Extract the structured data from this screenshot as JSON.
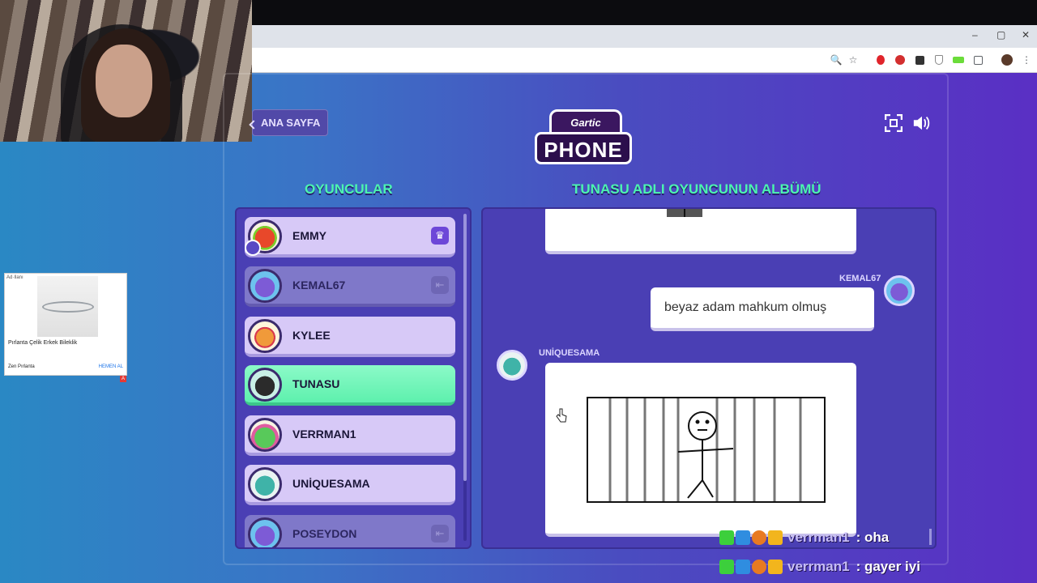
{
  "browser": {
    "window_controls": [
      "–",
      "▢",
      "✕"
    ],
    "toolbar_icons": [
      "zoom-icon",
      "star-icon",
      "opera-icon",
      "shield-icon",
      "extension-icon",
      "puzzle-icon",
      "profile-icon",
      "menu-icon"
    ]
  },
  "ad": {
    "tag": "Ad·Ilanı",
    "title": "Pırlanta Çelik Erkek Bileklik",
    "brand": "Zen Pırlanta",
    "cta": "HEMEN AL",
    "badge": "A"
  },
  "header": {
    "home_button": "ANA SAYFA",
    "logo_top": "Gartic",
    "logo_main": "PHONE"
  },
  "players": {
    "title": "OYUNCULAR",
    "list": [
      {
        "name": "EMMY",
        "state": "normal",
        "icon": "crown-icon"
      },
      {
        "name": "KEMAL67",
        "state": "inactive",
        "icon": "leave-icon"
      },
      {
        "name": "KYLEE",
        "state": "normal",
        "icon": ""
      },
      {
        "name": "TUNASU",
        "state": "active",
        "icon": ""
      },
      {
        "name": "VERRMAN1",
        "state": "normal",
        "icon": ""
      },
      {
        "name": "UNİQUESAMA",
        "state": "normal",
        "icon": ""
      },
      {
        "name": "POSEYDON",
        "state": "inactive",
        "icon": "leave-icon"
      }
    ]
  },
  "album": {
    "title": "TUNASU ADLI OYUNCUNUN ALBÜMÜ",
    "entries": [
      {
        "author": "KEMAL67",
        "type": "text",
        "content": "beyaz adam mahkum olmuş"
      },
      {
        "author": "UNİQUESAMA",
        "type": "drawing",
        "content": "stick-figure-behind-bars"
      }
    ]
  },
  "chat": [
    {
      "user": "verrman1",
      "message": ": oha"
    },
    {
      "user": "verrman1",
      "message": ": gayer iyi"
    }
  ],
  "colors": {
    "accent_green": "#4cf5b0",
    "panel_purple": "#4a3fb4",
    "card_lilac": "#d7c9f7"
  }
}
